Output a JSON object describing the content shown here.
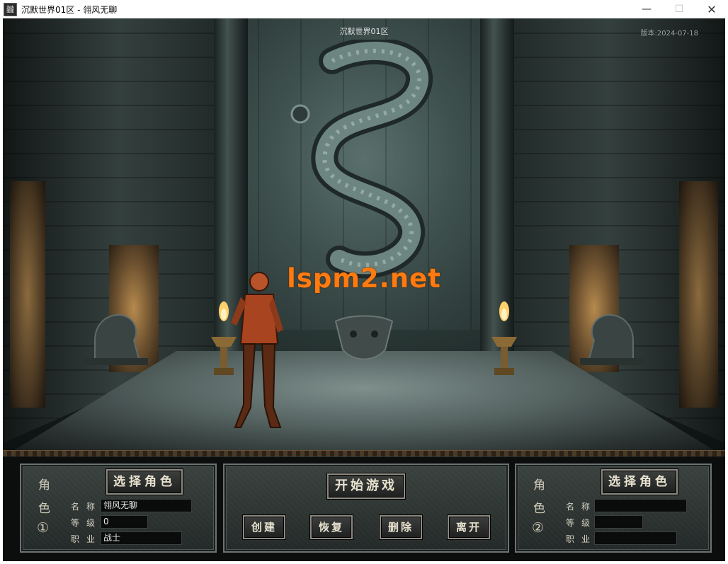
{
  "window": {
    "title": "沉默世界01区 - 翎风无聊",
    "icon_glyph": "龖",
    "minimize_glyph": "—",
    "maximize_glyph": "☐",
    "close_glyph": "✕"
  },
  "scene": {
    "server_title": "沉默世界01区",
    "version": "版本:2024-07-18",
    "watermark": "lspm2.net",
    "watermark_color": "#ff7a10"
  },
  "slot1": {
    "vertical_label": [
      "角",
      "色",
      "①"
    ],
    "select_button": "选择角色",
    "name_label": "名称",
    "level_label": "等级",
    "class_label": "职业",
    "name_value": "翎风无聊",
    "level_value": "0",
    "class_value": "战士"
  },
  "center": {
    "start_button": "开始游戏",
    "create_button": "创建",
    "restore_button": "恢复",
    "delete_button": "删除",
    "exit_button": "离开"
  },
  "slot2": {
    "vertical_label": [
      "角",
      "色",
      "②"
    ],
    "select_button": "选择角色",
    "name_label": "名称",
    "level_label": "等级",
    "class_label": "职业",
    "name_value": "",
    "level_value": "",
    "class_value": ""
  }
}
